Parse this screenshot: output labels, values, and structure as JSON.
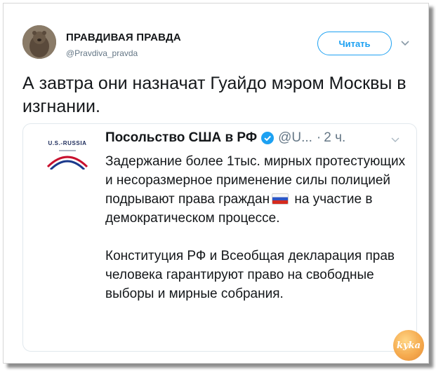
{
  "tweet": {
    "display_name": "ПРАВДИВАЯ ПРАВДА",
    "handle": "@Pravdiva_pravda",
    "follow_label": "Читать",
    "text": "А завтра они назначат Гуайдо мэром Москвы в изгнании."
  },
  "quoted": {
    "logo_text": "U.S.-RUSSIA",
    "name": "Посольство США в РФ",
    "handle": "@U...",
    "dot": "·",
    "time": "2 ч.",
    "p1_before_flag": "Задержание более 1тыс. мирных протестующих и несоразмерное применение силы полицией подрывают права граждан",
    "flag_icon": "russia-flag-emoji",
    "p1_after_flag": "на участие в демократическом процессе.",
    "p2": "Конституция РФ и Всеобщая декларация прав человека гарантируют право на свободные выборы и мирные собрания."
  },
  "watermark": {
    "text": "kyka"
  },
  "colors": {
    "accent": "#1da1f2",
    "text": "#14171a",
    "muted": "#657786",
    "border": "#e1e8ed"
  }
}
